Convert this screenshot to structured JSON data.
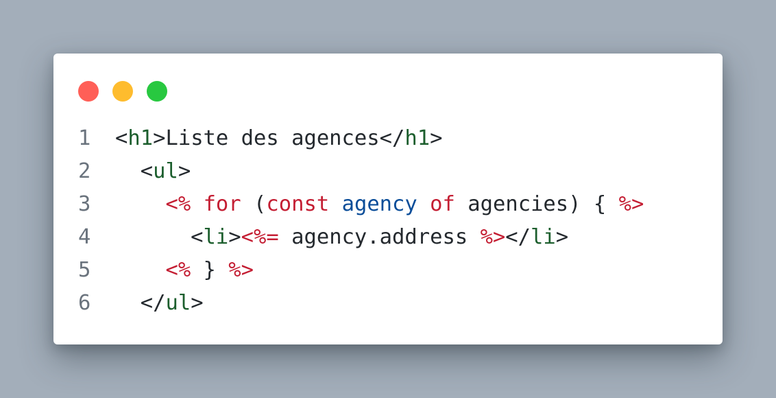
{
  "colors": {
    "background": "#a3aeba",
    "window": "#ffffff",
    "dot_close": "#ff5f57",
    "dot_minimize": "#febc2e",
    "dot_maximize": "#28c840",
    "text": "#24292e",
    "tag": "#1c5e2d",
    "keyword": "#c41e33",
    "variable": "#0a4d99",
    "line_number": "#6a737d"
  },
  "code": {
    "lines": [
      {
        "number": "1",
        "tokens": [
          {
            "t": "<",
            "k": "txt"
          },
          {
            "t": "h1",
            "k": "tag"
          },
          {
            "t": ">Liste des agences</",
            "k": "txt"
          },
          {
            "t": "h1",
            "k": "tag"
          },
          {
            "t": ">",
            "k": "txt"
          }
        ]
      },
      {
        "number": "2",
        "tokens": [
          {
            "t": "  <",
            "k": "txt"
          },
          {
            "t": "ul",
            "k": "tag"
          },
          {
            "t": ">",
            "k": "txt"
          }
        ]
      },
      {
        "number": "3",
        "tokens": [
          {
            "t": "    ",
            "k": "txt"
          },
          {
            "t": "<%",
            "k": "kw"
          },
          {
            "t": " ",
            "k": "txt"
          },
          {
            "t": "for",
            "k": "kw"
          },
          {
            "t": " (",
            "k": "txt"
          },
          {
            "t": "const",
            "k": "kw"
          },
          {
            "t": " ",
            "k": "txt"
          },
          {
            "t": "agency",
            "k": "var"
          },
          {
            "t": " ",
            "k": "txt"
          },
          {
            "t": "of",
            "k": "kw"
          },
          {
            "t": " agencies) { ",
            "k": "txt"
          },
          {
            "t": "%>",
            "k": "kw"
          }
        ]
      },
      {
        "number": "4",
        "tokens": [
          {
            "t": "      <",
            "k": "txt"
          },
          {
            "t": "li",
            "k": "tag"
          },
          {
            "t": ">",
            "k": "txt"
          },
          {
            "t": "<%=",
            "k": "kw"
          },
          {
            "t": " agency.address ",
            "k": "txt"
          },
          {
            "t": "%>",
            "k": "kw"
          },
          {
            "t": "</",
            "k": "txt"
          },
          {
            "t": "li",
            "k": "tag"
          },
          {
            "t": ">",
            "k": "txt"
          }
        ]
      },
      {
        "number": "5",
        "tokens": [
          {
            "t": "    ",
            "k": "txt"
          },
          {
            "t": "<%",
            "k": "kw"
          },
          {
            "t": " } ",
            "k": "txt"
          },
          {
            "t": "%>",
            "k": "kw"
          }
        ]
      },
      {
        "number": "6",
        "tokens": [
          {
            "t": "  </",
            "k": "txt"
          },
          {
            "t": "ul",
            "k": "tag"
          },
          {
            "t": ">",
            "k": "txt"
          }
        ]
      }
    ]
  }
}
